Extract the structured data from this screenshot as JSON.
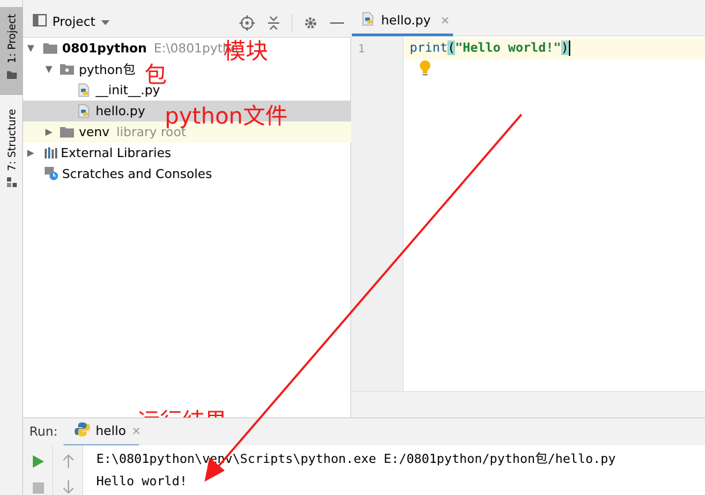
{
  "left_strip": {
    "project_tab": "1: Project",
    "structure_tab": "7: Structure"
  },
  "project_panel": {
    "title": "Project",
    "tree": {
      "root_name": "0801python",
      "root_path": "E:\\0801pytho",
      "package_name": "python包",
      "file_init": "__init__.py",
      "file_hello": "hello.py",
      "venv_name": "venv",
      "venv_hint": "library root",
      "external_libraries": "External Libraries",
      "scratches": "Scratches and Consoles"
    }
  },
  "annotations": {
    "module": "模块",
    "package": "包",
    "python_file": "python文件",
    "run_result": "运行结果"
  },
  "editor": {
    "tab_label": "hello.py",
    "line_number": "1",
    "code_fn": "print",
    "code_open": "(",
    "code_str": "\"Hello world!\"",
    "code_close": ")"
  },
  "run_panel": {
    "label": "Run:",
    "tab_label": "hello",
    "console_line1": "E:\\0801python\\venv\\Scripts\\python.exe E:/0801python/python包/hello.py",
    "console_line2": "Hello world!"
  },
  "colors": {
    "accent_blue": "#4083c9",
    "annotation_red": "#f01a1a",
    "run_green": "#3fa63f"
  }
}
